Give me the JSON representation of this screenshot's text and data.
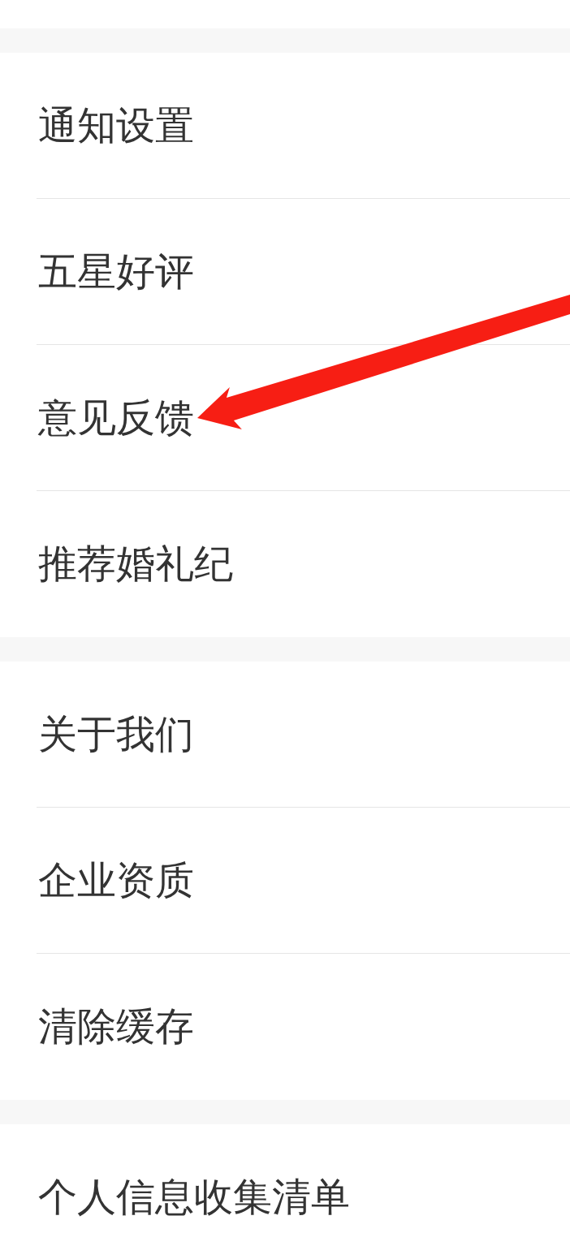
{
  "sections": [
    {
      "items": [
        {
          "label": "通知设置",
          "annotated": false
        },
        {
          "label": "五星好评",
          "annotated": false
        },
        {
          "label": "意见反馈",
          "annotated": true
        },
        {
          "label": "推荐婚礼纪",
          "annotated": false
        }
      ]
    },
    {
      "items": [
        {
          "label": "关于我们",
          "annotated": false
        },
        {
          "label": "企业资质",
          "annotated": false
        },
        {
          "label": "清除缓存",
          "annotated": false
        }
      ]
    },
    {
      "items": [
        {
          "label": "个人信息收集清单",
          "annotated": false
        }
      ]
    }
  ]
}
